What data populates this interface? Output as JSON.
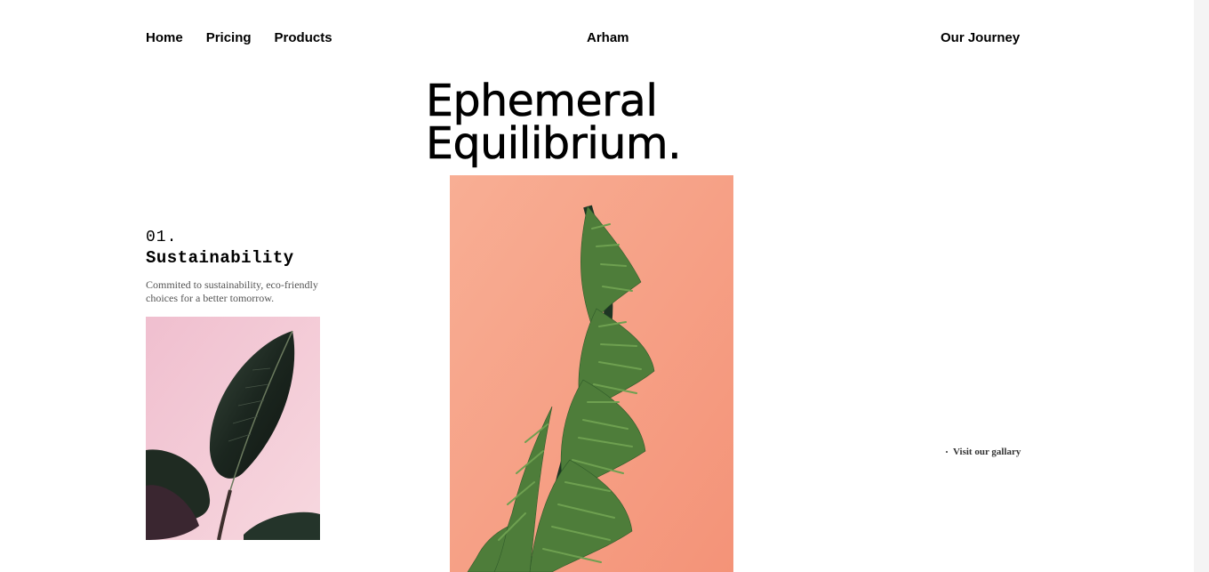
{
  "nav": {
    "items": [
      {
        "label": "Home"
      },
      {
        "label": "Pricing"
      },
      {
        "label": "Products"
      }
    ],
    "brand": "Arham",
    "journey": "Our Journey"
  },
  "hero": {
    "line1": "Ephemeral",
    "line2": "Equilibrium."
  },
  "feature": {
    "number": "01.",
    "heading": "Sustainability",
    "description": "Commited to sustainability, eco-friendly choices for a better tomorrow."
  },
  "gallery": {
    "label": "Visit our gallary"
  },
  "colors": {
    "small_image_bg": "#f3c8d3",
    "big_image_bg": "#f7a386",
    "leaf_dark": "#1e2b22",
    "plant_green": "#4d7b36"
  }
}
